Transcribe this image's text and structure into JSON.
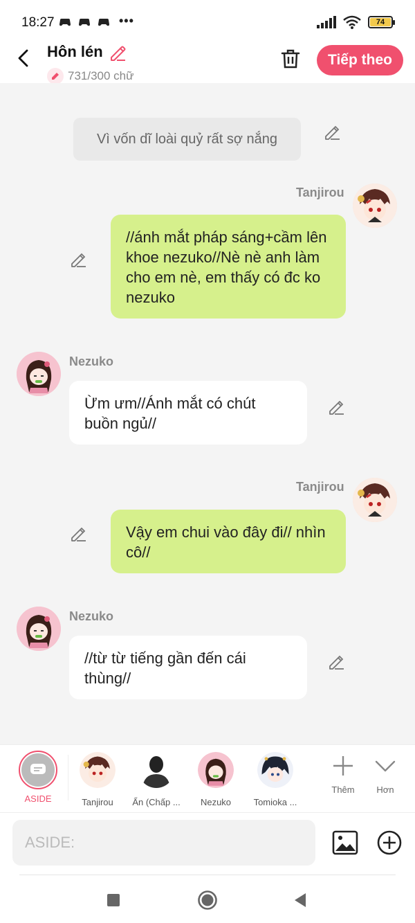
{
  "status": {
    "time": "18:27",
    "more": "•••",
    "battery": "74"
  },
  "header": {
    "title": "Hôn lén",
    "counter": "731/300 chữ",
    "next_label": "Tiếp theo"
  },
  "chat": {
    "narration": "Vì vốn dĩ loài quỷ rất sợ nắng",
    "messages": [
      {
        "sender": "Tanjirou",
        "text": "//ánh mắt pháp sáng+cầm lên khoe nezuko//Nè nè anh làm cho em nè, em thấy có đc ko nezuko"
      },
      {
        "sender": "Nezuko",
        "text": "Ừm ưm//Ánh mắt có chút buồn ngủ//"
      },
      {
        "sender": "Tanjirou",
        "text": "Vậy em chui vào đây đi// nhìn cô//"
      },
      {
        "sender": "Nezuko",
        "text": "//từ từ tiếng gần đến cái thùng//"
      }
    ]
  },
  "characters": {
    "aside_label": "ASIDE",
    "items": [
      {
        "name": "Tanjirou"
      },
      {
        "name": "Ẩn (Chấp ..."
      },
      {
        "name": "Nezuko"
      },
      {
        "name": "Tomioka ..."
      }
    ],
    "add_label": "Thêm",
    "more_label": "Hơn"
  },
  "input": {
    "placeholder": "ASIDE:"
  },
  "colors": {
    "accent": "#f0506e",
    "bubble_green": "#d6f08c",
    "bubble_white": "#ffffff"
  }
}
